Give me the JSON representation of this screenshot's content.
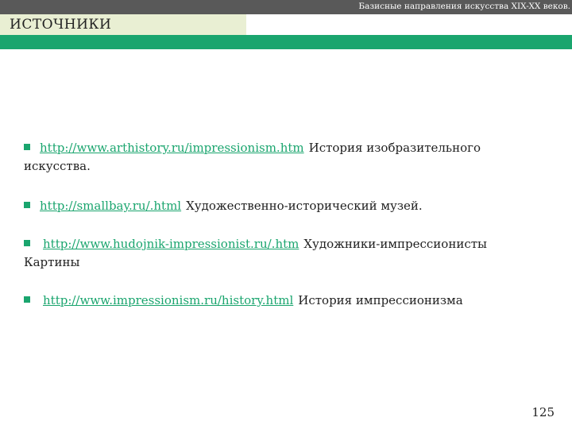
{
  "header": {
    "course_title": "Базисные направления искусства XIX-XX веков.",
    "section_title": "ИСТОЧНИКИ"
  },
  "sources": [
    {
      "url": "http://www.arthistory.ru/impressionism.htm",
      "description": "История изобразительного",
      "description_cont": "искусства."
    },
    {
      "url": "http://smallbay.ru/.html",
      "description": "Художественно-исторический музей.",
      "description_cont": ""
    },
    {
      "url": "http://www.hudojnik-impressionist.ru/.htm",
      "description": "Художники-импрессионисты",
      "description_cont": "Картины"
    },
    {
      "url": "http://www.impressionism.ru/history.html",
      "description": "История импрессионизма",
      "description_cont": ""
    }
  ],
  "page_number": "125",
  "colors": {
    "accent": "#1aa56e",
    "header_bar": "#595959",
    "title_background": "#e9efd3"
  }
}
